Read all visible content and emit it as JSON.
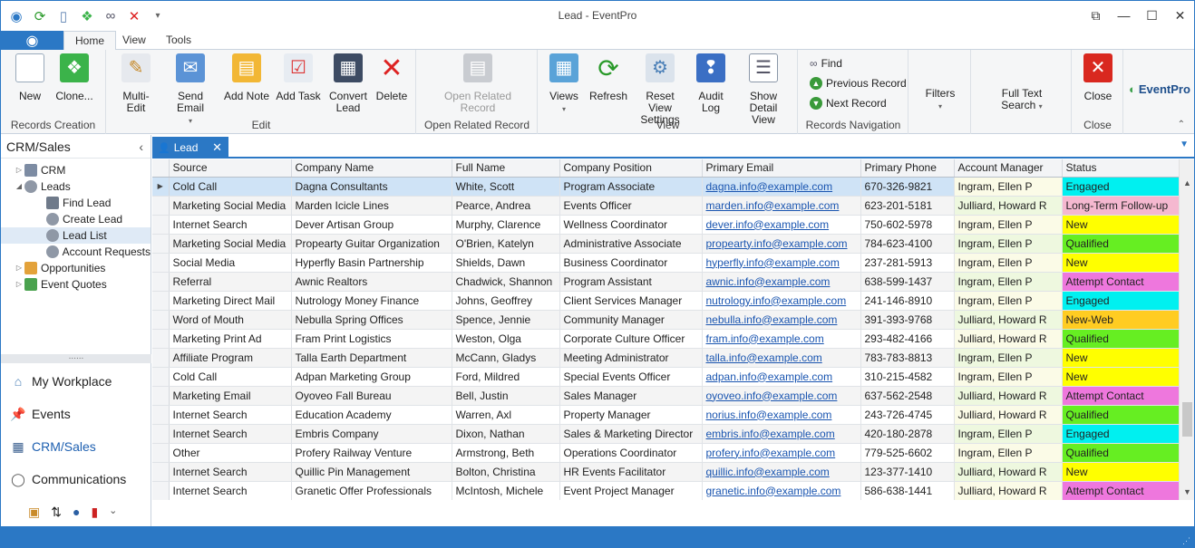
{
  "window": {
    "title": "Lead - EventPro",
    "restore": "⧉",
    "minimize": "—",
    "maximize": "☐",
    "close": "✕"
  },
  "ribbon_tabs": [
    "Home",
    "View",
    "Tools"
  ],
  "ribbon": {
    "records_creation": {
      "label": "Records Creation",
      "new": "New",
      "clone": "Clone..."
    },
    "edit": {
      "label": "Edit",
      "multi_edit": "Multi-Edit",
      "send_email": "Send Email",
      "add_note": "Add Note",
      "add_task": "Add Task",
      "convert_lead_1": "Convert",
      "convert_lead_2": "Lead",
      "delete": "Delete"
    },
    "open_related": {
      "label": "Open Related Record",
      "btn_1": "Open Related",
      "btn_2": "Record"
    },
    "view": {
      "label": "View",
      "views": "Views",
      "refresh": "Refresh",
      "reset_1": "Reset View",
      "reset_2": "Settings",
      "audit_1": "Audit",
      "audit_2": "Log",
      "detail_1": "Show Detail",
      "detail_2": "View"
    },
    "nav": {
      "label": "Records Navigation",
      "find": "Find",
      "previous": "Previous Record",
      "next": "Next Record"
    },
    "filters": "Filters",
    "fulltext_1": "Full Text",
    "fulltext_2": "Search",
    "close_group": {
      "label": "Close",
      "close": "Close"
    },
    "brand": "EventPro"
  },
  "sidebar": {
    "title": "CRM/Sales",
    "tree": [
      "CRM",
      "Leads",
      "Find Lead",
      "Create Lead",
      "Lead List",
      "Account Requests",
      "Opportunities",
      "Event Quotes"
    ],
    "splitter": "......",
    "nav": [
      "My Workplace",
      "Events",
      "CRM/Sales",
      "Communications"
    ]
  },
  "doc_tab": "Lead",
  "columns": [
    "Source",
    "Company Name",
    "Full Name",
    "Company Position",
    "Primary Email",
    "Primary Phone",
    "Account Manager",
    "Status"
  ],
  "rows": [
    [
      "Cold Call",
      "Dagna Consultants",
      "White, Scott",
      "Program Associate",
      "dagna.info@example.com",
      "670-326-9821",
      "Ingram, Ellen P",
      "Engaged"
    ],
    [
      "Marketing Social Media",
      "Marden Icicle Lines",
      "Pearce, Andrea",
      "Events Officer",
      "marden.info@example.com",
      "623-201-5181",
      "Julliard, Howard R",
      "Long-Term Follow-up"
    ],
    [
      "Internet Search",
      "Dever Artisan Group",
      "Murphy, Clarence",
      "Wellness Coordinator",
      "dever.info@example.com",
      "750-602-5978",
      "Ingram, Ellen P",
      "New"
    ],
    [
      "Marketing Social Media",
      "Propearty Guitar Organization",
      "O'Brien, Katelyn",
      "Administrative Associate",
      "propearty.info@example.com",
      "784-623-4100",
      "Ingram, Ellen P",
      "Qualified"
    ],
    [
      "Social Media",
      "Hyperfly Basin Partnership",
      "Shields, Dawn",
      "Business Coordinator",
      "hyperfly.info@example.com",
      "237-281-5913",
      "Ingram, Ellen P",
      "New"
    ],
    [
      "Referral",
      "Awnic Realtors",
      "Chadwick, Shannon",
      "Program Assistant",
      "awnic.info@example.com",
      "638-599-1437",
      "Ingram, Ellen P",
      "Attempt Contact"
    ],
    [
      "Marketing Direct Mail",
      "Nutrology Money Finance",
      "Johns, Geoffrey",
      "Client Services Manager",
      "nutrology.info@example.com",
      "241-146-8910",
      "Ingram, Ellen P",
      "Engaged"
    ],
    [
      "Word of Mouth",
      "Nebulla Spring Offices",
      "Spence, Jennie",
      "Community Manager",
      "nebulla.info@example.com",
      "391-393-9768",
      "Julliard, Howard R",
      "New-Web"
    ],
    [
      "Marketing Print Ad",
      "Fram Print Logistics",
      "Weston, Olga",
      "Corporate Culture Officer",
      "fram.info@example.com",
      "293-482-4166",
      "Julliard, Howard R",
      "Qualified"
    ],
    [
      "Affiliate Program",
      "Talla Earth Department",
      "McCann, Gladys",
      "Meeting Administrator",
      "talla.info@example.com",
      "783-783-8813",
      "Ingram, Ellen P",
      "New"
    ],
    [
      "Cold Call",
      "Adpan Marketing Group",
      "Ford, Mildred",
      "Special Events Officer",
      "adpan.info@example.com",
      "310-215-4582",
      "Ingram, Ellen P",
      "New"
    ],
    [
      "Marketing Email",
      "Oyoveo Fall Bureau",
      "Bell, Justin",
      "Sales Manager",
      "oyoveo.info@example.com",
      "637-562-2548",
      "Julliard, Howard R",
      "Attempt Contact"
    ],
    [
      "Internet Search",
      "Education Academy",
      "Warren, Axl",
      "Property Manager",
      "norius.info@example.com",
      "243-726-4745",
      "Julliard, Howard R",
      "Qualified"
    ],
    [
      "Internet Search",
      "Embris Company",
      "Dixon, Nathan",
      "Sales & Marketing Director",
      "embris.info@example.com",
      "420-180-2878",
      "Ingram, Ellen P",
      "Engaged"
    ],
    [
      "Other",
      "Profery Railway Venture",
      "Armstrong, Beth",
      "Operations Coordinator",
      "profery.info@example.com",
      "779-525-6602",
      "Ingram, Ellen P",
      "Qualified"
    ],
    [
      "Internet Search",
      "Quillic Pin Management",
      "Bolton, Christina",
      "HR Events Facilitator",
      "quillic.info@example.com",
      "123-377-1410",
      "Julliard, Howard R",
      "New"
    ],
    [
      "Internet Search",
      "Granetic Offer Professionals",
      "McIntosh, Michele",
      "Event Project Manager",
      "granetic.info@example.com",
      "586-638-1441",
      "Julliard, Howard R",
      "Attempt Contact"
    ]
  ],
  "status_colors": {
    "Engaged": "#00f0f0",
    "Long-Term Follow-up": "#f5b8d0",
    "New": "#ffff00",
    "Qualified": "#66ee22",
    "Attempt Contact": "#ee77dd",
    "New-Web": "#ffcc22"
  },
  "accent": "#2b78c5"
}
